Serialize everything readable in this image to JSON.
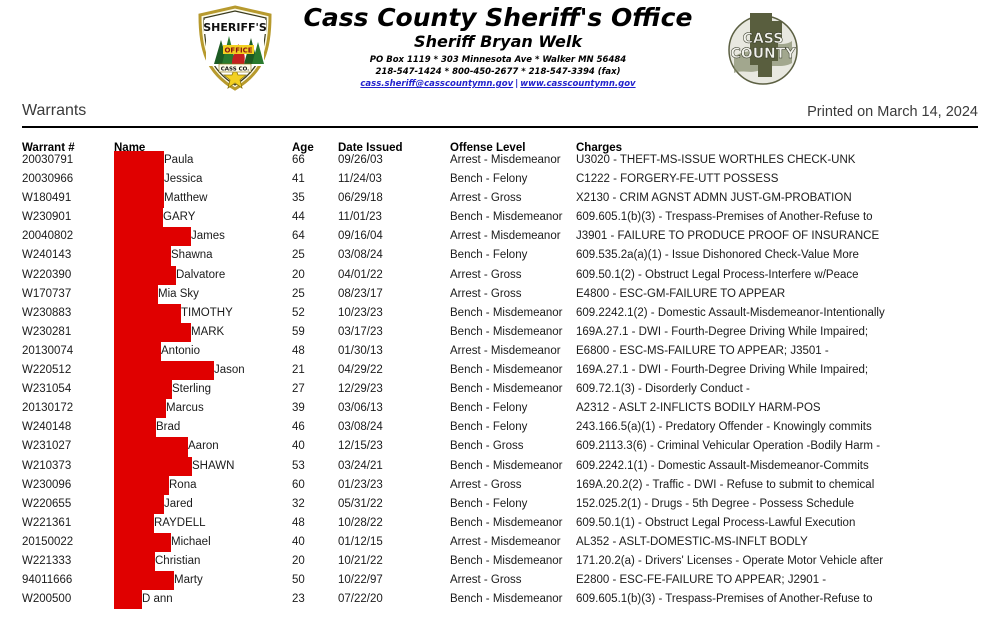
{
  "letterhead": {
    "badge_left_name": "sheriff-office-badge",
    "badge_left_text_top": "SHERIFF'S",
    "badge_left_text_mid": "OFFICE",
    "badge_left_text_bottom": "CASS CO.",
    "logo_right_name": "cass-county-logo",
    "logo_right_text_top": "CASS",
    "logo_right_text_bottom": "COUNTY",
    "org_name": "Cass County Sheriff's Office",
    "sheriff_name": "Sheriff Bryan Welk",
    "address": "PO Box 1119 * 303 Minnesota Ave * Walker MN 56484",
    "phones": "218-547-1424 * 800-450-2677 * 218-547-3394 (fax)",
    "email": "cass.sheriff@casscountymn.gov",
    "link_separator": "|",
    "website": "www.casscountymn.gov"
  },
  "titlebar": {
    "title": "Warrants",
    "printed_on": "Printed on March 14, 2024"
  },
  "table": {
    "columns": {
      "warrant": "Warrant #",
      "name": "Name",
      "age": "Age",
      "date_issued": "Date Issued",
      "offense_level": "Offense Level",
      "charges": "Charges"
    },
    "redaction_color": "#e00000",
    "rows": [
      {
        "warrant": "20030791",
        "name": "Paula",
        "redact_w": 50,
        "age": "66",
        "date": "09/26/03",
        "offense": "Arrest - Misdemeanor",
        "charge": "U3020 - THEFT-MS-ISSUE WORTHLES CHECK-UNK"
      },
      {
        "warrant": "20030966",
        "name": "Jessica",
        "redact_w": 50,
        "age": "41",
        "date": "11/24/03",
        "offense": "Bench - Felony",
        "charge": "C1222 - FORGERY-FE-UTT POSSESS"
      },
      {
        "warrant": "W180491",
        "name": "Matthew",
        "redact_w": 50,
        "age": "35",
        "date": "06/29/18",
        "offense": "Arrest - Gross",
        "charge": "X2130 - CRIM AGNST ADMN JUST-GM-PROBATION"
      },
      {
        "warrant": "W230901",
        "name": "GARY",
        "redact_w": 49,
        "age": "44",
        "date": "11/01/23",
        "offense": "Bench - Misdemeanor",
        "charge": "609.605.1(b)(3) - Trespass-Premises of Another-Refuse to"
      },
      {
        "warrant": "20040802",
        "name": "James",
        "redact_w": 77,
        "age": "64",
        "date": "09/16/04",
        "offense": "Arrest - Misdemeanor",
        "charge": "J3901 - FAILURE TO PRODUCE PROOF OF INSURANCE"
      },
      {
        "warrant": "W240143",
        "name": "Shawna",
        "redact_w": 57,
        "age": "25",
        "date": "03/08/24",
        "offense": "Bench - Felony",
        "charge": "609.535.2a(a)(1) - Issue Dishonored Check-Value More"
      },
      {
        "warrant": "W220390",
        "name": "Dalvatore",
        "redact_w": 62,
        "age": "20",
        "date": "04/01/22",
        "offense": "Arrest - Gross",
        "charge": "609.50.1(2) - Obstruct Legal Process-Interfere w/Peace"
      },
      {
        "warrant": "W170737",
        "name": "Mia Sky",
        "redact_w": 44,
        "age": "25",
        "date": "08/23/17",
        "offense": "Arrest - Gross",
        "charge": "E4800 - ESC-GM-FAILURE TO APPEAR"
      },
      {
        "warrant": "W230883",
        "name": "TIMOTHY",
        "redact_w": 67,
        "age": "52",
        "date": "10/23/23",
        "offense": "Bench - Misdemeanor",
        "charge": "609.2242.1(2) - Domestic Assault-Misdemeanor-Intentionally"
      },
      {
        "warrant": "W230281",
        "name": "MARK",
        "redact_w": 77,
        "age": "59",
        "date": "03/17/23",
        "offense": "Bench - Misdemeanor",
        "charge": "169A.27.1 - DWI - Fourth-Degree Driving While Impaired;"
      },
      {
        "warrant": "20130074",
        "name": "Antonio",
        "redact_w": 47,
        "age": "48",
        "date": "01/30/13",
        "offense": "Arrest - Misdemeanor",
        "charge": "E6800 - ESC-MS-FAILURE TO APPEAR; J3501 -"
      },
      {
        "warrant": "W220512",
        "name": "Jason",
        "redact_w": 100,
        "age": "21",
        "date": "04/29/22",
        "offense": "Bench - Misdemeanor",
        "charge": "169A.27.1 - DWI - Fourth-Degree Driving While Impaired;"
      },
      {
        "warrant": "W231054",
        "name": "Sterling",
        "redact_w": 58,
        "age": "27",
        "date": "12/29/23",
        "offense": "Bench - Misdemeanor",
        "charge": "609.72.1(3) - Disorderly Conduct -"
      },
      {
        "warrant": "20130172",
        "name": "Marcus",
        "redact_w": 52,
        "age": "39",
        "date": "03/06/13",
        "offense": "Bench - Felony",
        "charge": "A2312 - ASLT 2-INFLICTS BODILY HARM-POS"
      },
      {
        "warrant": "W240148",
        "name": "Brad",
        "redact_w": 42,
        "age": "46",
        "date": "03/08/24",
        "offense": "Bench - Felony",
        "charge": "243.166.5(a)(1) - Predatory Offender - Knowingly commits"
      },
      {
        "warrant": "W231027",
        "name": "Aaron",
        "redact_w": 74,
        "age": "40",
        "date": "12/15/23",
        "offense": "Bench - Gross",
        "charge": "609.2113.3(6) - Criminal Vehicular Operation -Bodily Harm -"
      },
      {
        "warrant": "W210373",
        "name": "SHAWN",
        "redact_w": 78,
        "age": "53",
        "date": "03/24/21",
        "offense": "Bench - Misdemeanor",
        "charge": "609.2242.1(1) - Domestic Assault-Misdemeanor-Commits"
      },
      {
        "warrant": "W230096",
        "name": "Rona",
        "redact_w": 55,
        "age": "60",
        "date": "01/23/23",
        "offense": "Arrest - Gross",
        "charge": "169A.20.2(2) - Traffic - DWI - Refuse to submit to chemical"
      },
      {
        "warrant": "W220655",
        "name": "Jared",
        "redact_w": 50,
        "age": "32",
        "date": "05/31/22",
        "offense": "Bench - Felony",
        "charge": "152.025.2(1) - Drugs - 5th Degree - Possess Schedule"
      },
      {
        "warrant": "W221361",
        "name": "RAYDELL",
        "redact_w": 40,
        "age": "48",
        "date": "10/28/22",
        "offense": "Bench - Misdemeanor",
        "charge": "609.50.1(1) - Obstruct Legal Process-Lawful Execution"
      },
      {
        "warrant": "20150022",
        "name": "Michael",
        "redact_w": 57,
        "age": "40",
        "date": "01/12/15",
        "offense": "Arrest - Misdemeanor",
        "charge": "AL352 - ASLT-DOMESTIC-MS-INFLT BODLY"
      },
      {
        "warrant": "W221333",
        "name": "Christian",
        "redact_w": 41,
        "age": "20",
        "date": "10/21/22",
        "offense": "Bench - Misdemeanor",
        "charge": "171.20.2(a) - Drivers' Licenses - Operate Motor Vehicle after"
      },
      {
        "warrant": "94011666",
        "name": "Marty",
        "redact_w": 60,
        "age": "50",
        "date": "10/22/97",
        "offense": "Arrest - Gross",
        "charge": "E2800 - ESC-FE-FAILURE TO APPEAR; J2901 -"
      },
      {
        "warrant": "W200500",
        "name": "D ann",
        "redact_w": 28,
        "age": "23",
        "date": "07/22/20",
        "offense": "Bench - Misdemeanor",
        "charge": "609.605.1(b)(3) - Trespass-Premises of Another-Refuse to"
      }
    ]
  }
}
